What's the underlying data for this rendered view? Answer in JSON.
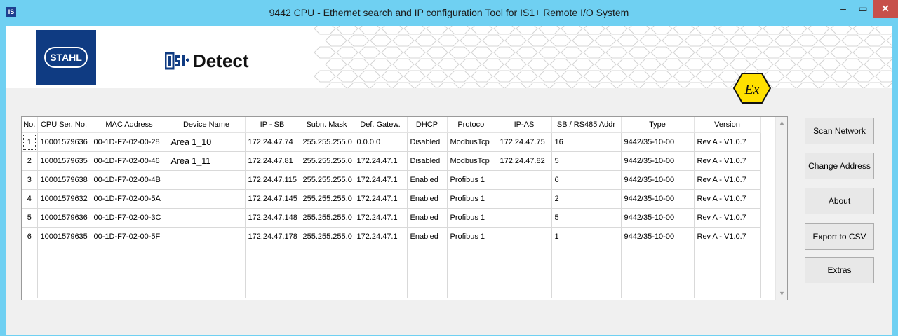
{
  "window": {
    "app_icon_text": "IS",
    "title": "9442 CPU - Ethernet search and IP configuration Tool for IS1+ Remote I/O System",
    "minimize_glyph": "–",
    "maximize_glyph": "▭",
    "close_glyph": "✕"
  },
  "header": {
    "logo_text": "STAHL",
    "brand_text": "Detect",
    "ex_text": "Ex",
    "colors": {
      "brand_blue": "#0f3b82",
      "ex_yellow": "#ffe000",
      "titlebar": "#6fd0f2"
    }
  },
  "table": {
    "columns": [
      "No.",
      "CPU Ser. No.",
      "MAC Address",
      "Device Name",
      "IP - SB",
      "Subn. Mask",
      "Def. Gatew.",
      "DHCP",
      "Protocol",
      "IP-AS",
      "SB / RS485 Addr",
      "Type",
      "Version"
    ],
    "rows": [
      [
        "1",
        "10001579636",
        "00-1D-F7-02-00-28",
        "Area 1_10",
        "172.24.47.74",
        "255.255.255.0",
        "0.0.0.0",
        "Disabled",
        "ModbusTcp",
        "172.24.47.75",
        "16",
        "9442/35-10-00",
        "Rev A - V1.0.7"
      ],
      [
        "2",
        "10001579635",
        "00-1D-F7-02-00-46",
        "Area 1_11",
        "172.24.47.81",
        "255.255.255.0",
        "172.24.47.1",
        "Disabled",
        "ModbusTcp",
        "172.24.47.82",
        "5",
        "9442/35-10-00",
        "Rev A - V1.0.7"
      ],
      [
        "3",
        "10001579638",
        "00-1D-F7-02-00-4B",
        "",
        "172.24.47.115",
        "255.255.255.0",
        "172.24.47.1",
        "Enabled",
        "Profibus 1",
        "",
        "6",
        "9442/35-10-00",
        "Rev A - V1.0.7"
      ],
      [
        "4",
        "10001579632",
        "00-1D-F7-02-00-5A",
        "",
        "172.24.47.145",
        "255.255.255.0",
        "172.24.47.1",
        "Enabled",
        "Profibus 1",
        "",
        "2",
        "9442/35-10-00",
        "Rev A - V1.0.7"
      ],
      [
        "5",
        "10001579636",
        "00-1D-F7-02-00-3C",
        "",
        "172.24.47.148",
        "255.255.255.0",
        "172.24.47.1",
        "Enabled",
        "Profibus 1",
        "",
        "5",
        "9442/35-10-00",
        "Rev A - V1.0.7"
      ],
      [
        "6",
        "10001579635",
        "00-1D-F7-02-00-5F",
        "",
        "172.24.47.178",
        "255.255.255.0",
        "172.24.47.1",
        "Enabled",
        "Profibus 1",
        "",
        "1",
        "9442/35-10-00",
        "Rev A - V1.0.7"
      ]
    ],
    "scroll_up_glyph": "▲",
    "scroll_down_glyph": "▼"
  },
  "buttons": {
    "scan": "Scan Network",
    "change": "Change Address",
    "about": "About",
    "export": "Export to CSV",
    "extras": "Extras"
  }
}
